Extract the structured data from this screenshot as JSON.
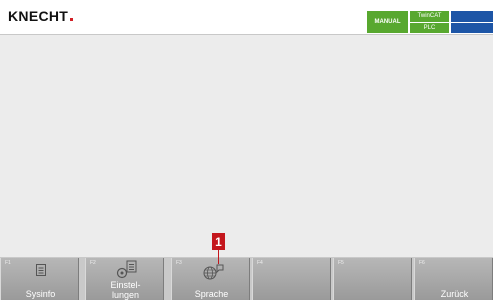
{
  "header": {
    "logo_text": "KNECHT",
    "status_mode": "MANUAL",
    "status_twincat": "TwinCAT",
    "status_plc": "PLC"
  },
  "colors": {
    "brand_red": "#d21f26",
    "status_green": "#58a82f",
    "status_blue": "#1d55a6",
    "callout_red": "#c4161c"
  },
  "fkeys": [
    {
      "key": "F1",
      "label": "Sysinfo",
      "icon": "sysinfo-icon"
    },
    {
      "key": "F2",
      "label": "Einstel-\nlungen",
      "label_line1": "Einstel-",
      "label_line2": "lungen",
      "icon": "settings-icon"
    },
    {
      "key": "F3",
      "label": "Sprache",
      "icon": "language-icon"
    },
    {
      "key": "F4",
      "label": ""
    },
    {
      "key": "F5",
      "label": ""
    },
    {
      "key": "F6",
      "label": "Zurück"
    }
  ],
  "callout": {
    "number": "1"
  }
}
